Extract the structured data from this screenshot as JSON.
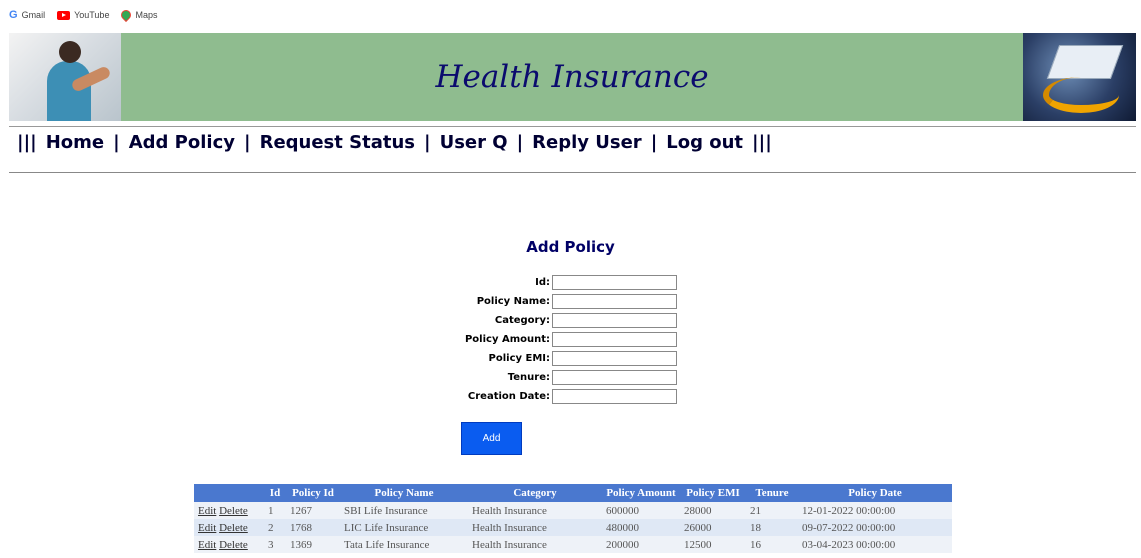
{
  "bookmarks": [
    {
      "label": "Gmail",
      "icon": "gmail-icon"
    },
    {
      "label": "YouTube",
      "icon": "youtube-icon"
    },
    {
      "label": "Maps",
      "icon": "maps-icon"
    }
  ],
  "banner": {
    "title": "Health Insurance",
    "bg_color": "#8fbc8f"
  },
  "nav": {
    "prefix": "|||",
    "separator": "|",
    "suffix": "|||",
    "items": [
      "Home",
      "Add Policy",
      "Request Status",
      "User Q",
      "Reply User",
      "Log out"
    ]
  },
  "form": {
    "title": "Add Policy",
    "fields": [
      {
        "label": "Id:",
        "value": ""
      },
      {
        "label": "Policy Name:",
        "value": ""
      },
      {
        "label": "Category:",
        "value": ""
      },
      {
        "label": "Policy Amount:",
        "value": ""
      },
      {
        "label": "Policy EMI:",
        "value": ""
      },
      {
        "label": "Tenure:",
        "value": ""
      },
      {
        "label": "Creation Date:",
        "value": ""
      }
    ],
    "submit_label": "Add"
  },
  "table": {
    "headers": [
      "",
      "Id",
      "Policy Id",
      "Policy Name",
      "Category",
      "Policy Amount",
      "Policy EMI",
      "Tenure",
      "Policy Date"
    ],
    "edit_label": "Edit",
    "delete_label": "Delete",
    "rows": [
      [
        "1",
        "1267",
        "SBI Life Insurance",
        "Health Insurance",
        "600000",
        "28000",
        "21",
        "12-01-2022 00:00:00"
      ],
      [
        "2",
        "1768",
        "LIC Life Insurance",
        "Health Insurance",
        "480000",
        "26000",
        "18",
        "09-07-2022 00:00:00"
      ],
      [
        "3",
        "1369",
        "Tata Life Insurance",
        "Health Insurance",
        "200000",
        "12500",
        "16",
        "03-04-2023 00:00:00"
      ]
    ]
  }
}
